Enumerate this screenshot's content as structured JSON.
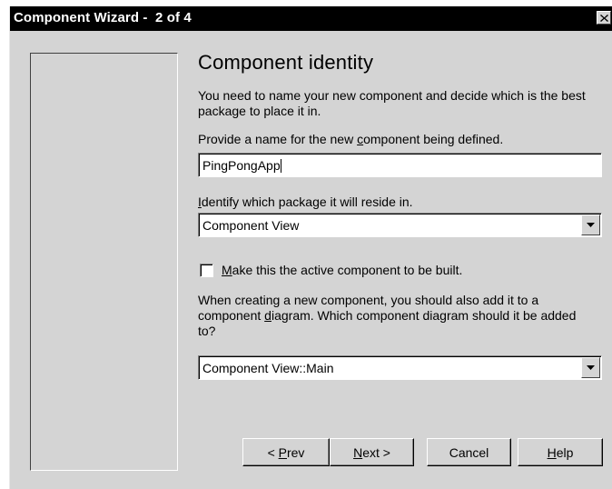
{
  "window": {
    "title": "Component Wizard -  2 of 4",
    "close_icon": "close-icon"
  },
  "page": {
    "heading": "Component identity",
    "intro": "You need to name your new component and decide which is the best package to place it in."
  },
  "name_field": {
    "label_before": "Provide a name for the new ",
    "label_mnemonic": "c",
    "label_after": "omponent being defined.",
    "value": "PingPongApp"
  },
  "package_field": {
    "label_mnemonic": "I",
    "label_after": "dentify which package it will reside in.",
    "selected": "Component View"
  },
  "active_checkbox": {
    "checked": false,
    "label_mnemonic": "M",
    "label_after": "ake this the active component to be built."
  },
  "diagram_field": {
    "label_before": "When creating a new component, you should also add it to a component ",
    "label_mnemonic": "d",
    "label_after": "iagram. Which component diagram should it be added to?",
    "selected": "Component View::Main"
  },
  "buttons": {
    "prev_prefix": "< ",
    "prev_mnemonic": "P",
    "prev_rest": "rev",
    "next_mnemonic": "N",
    "next_rest": "ext >",
    "cancel": "Cancel",
    "help_mnemonic": "H",
    "help_rest": "elp"
  },
  "colors": {
    "dialog_face": "#d4d4d4",
    "titlebar": "#000000",
    "field_bg": "#ffffff"
  }
}
